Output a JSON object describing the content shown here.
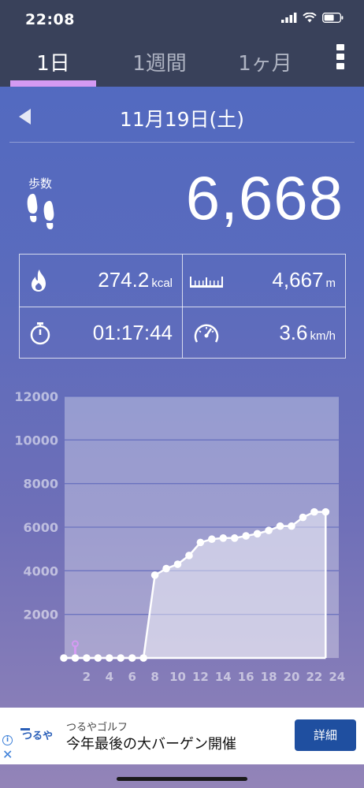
{
  "status_bar": {
    "time": "22:08"
  },
  "tabs": [
    {
      "label": "1日",
      "active": true
    },
    {
      "label": "1週間",
      "active": false
    },
    {
      "label": "1ヶ月",
      "active": false
    }
  ],
  "date": "11月19日(土)",
  "steps": {
    "label": "歩数",
    "value": "6,668"
  },
  "stats": {
    "calories": {
      "value": "274.2",
      "unit": "kcal",
      "icon": "flame-icon"
    },
    "distance": {
      "value": "4,667",
      "unit": "m",
      "icon": "ruler-icon"
    },
    "time": {
      "value": "01:17:44",
      "icon": "stopwatch-icon"
    },
    "speed": {
      "value": "3.6",
      "unit": "km/h",
      "icon": "speedometer-icon"
    }
  },
  "chart_data": {
    "type": "area",
    "x": [
      0,
      1,
      2,
      3,
      4,
      5,
      6,
      7,
      8,
      9,
      10,
      11,
      12,
      13,
      14,
      15,
      16,
      17,
      18,
      19,
      20,
      21,
      22,
      23
    ],
    "values": [
      0,
      0,
      0,
      0,
      0,
      0,
      0,
      0,
      3800,
      4100,
      4300,
      4700,
      5300,
      5450,
      5500,
      5500,
      5600,
      5700,
      5850,
      6050,
      6050,
      6450,
      6700,
      6700
    ],
    "x_ticks": [
      2,
      4,
      6,
      8,
      10,
      12,
      14,
      16,
      18,
      20,
      22,
      24
    ],
    "y_ticks": [
      2000,
      4000,
      6000,
      8000,
      10000,
      12000
    ],
    "xlim": [
      -0.5,
      24
    ],
    "ylim": [
      0,
      12000
    ],
    "grid": true
  },
  "ad": {
    "brand": "つるやゴルフ",
    "text": "今年最後の大バーゲン開催",
    "button": "詳細",
    "logo_text": "つるや",
    "info_icon": "i",
    "close_icon": "✕"
  },
  "colors": {
    "header_bg": "#39415a",
    "tab_indicator": "#d49af2",
    "ad_button": "#1f4fa0"
  }
}
